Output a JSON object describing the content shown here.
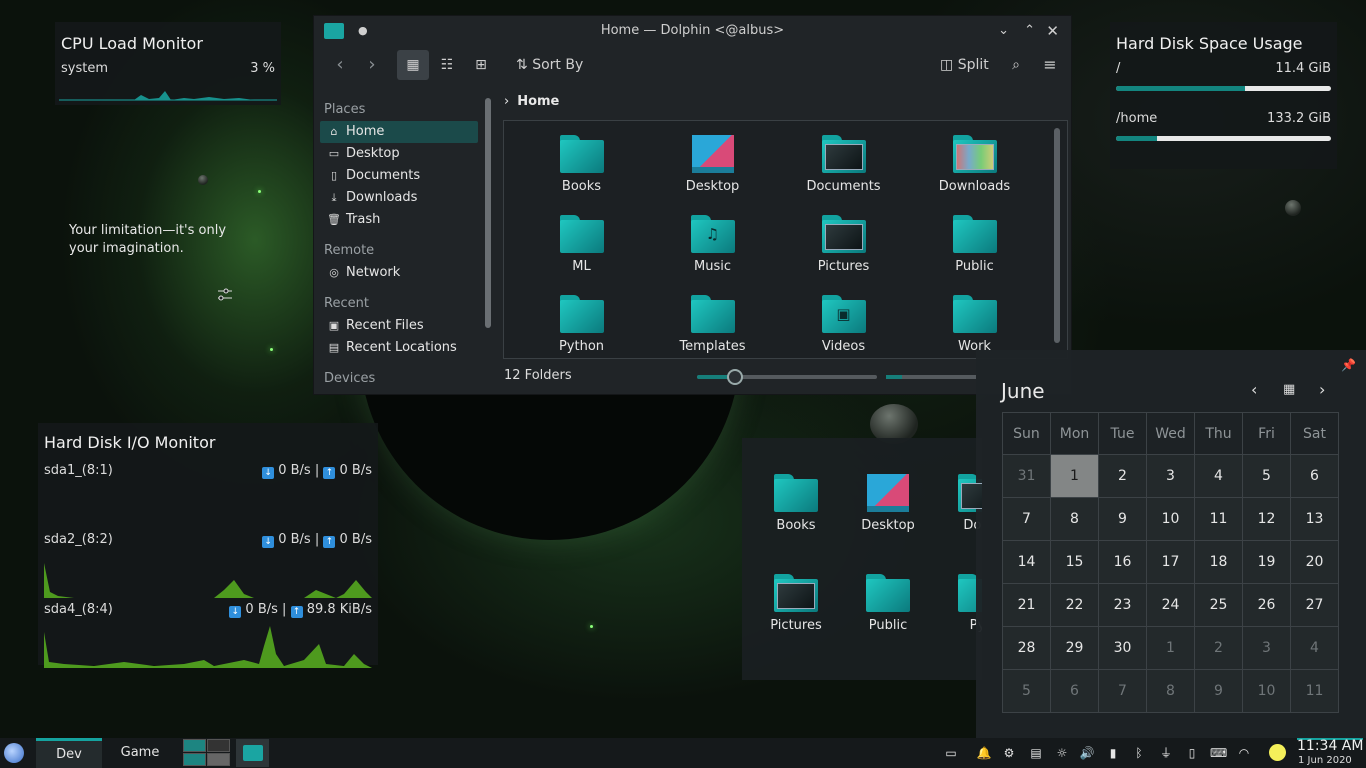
{
  "cpu": {
    "title": "CPU Load Monitor",
    "label": "system",
    "value": "3 %"
  },
  "quote": {
    "text": "Your limitation—it's only your imagination."
  },
  "disk_usage": {
    "title": "Hard Disk Space Usage",
    "drives": [
      {
        "label": "/",
        "value": "11.4 GiB",
        "fill": 0.6
      },
      {
        "label": "/home",
        "value": "133.2 GiB",
        "fill": 0.19
      }
    ]
  },
  "io": {
    "title": "Hard Disk I/O Monitor",
    "rows": [
      {
        "device": "sda1_(8:1)",
        "read": "0 B/s",
        "write": "0 B/s"
      },
      {
        "device": "sda2_(8:2)",
        "read": "0 B/s",
        "write": "0 B/s"
      },
      {
        "device": "sda4_(8:4)",
        "read": "0 B/s",
        "write": "89.8 KiB/s"
      }
    ]
  },
  "dolphin": {
    "title": "Home — Dolphin <@albus>",
    "sort_label": "Sort By",
    "split_label": "Split",
    "breadcrumb": "Home",
    "status": "12 Folders",
    "zoom": 0.2,
    "places_head": "Places",
    "places": [
      "Home",
      "Desktop",
      "Documents",
      "Downloads",
      "Trash"
    ],
    "remote_head": "Remote",
    "remote": [
      "Network"
    ],
    "recent_head": "Recent",
    "recent": [
      "Recent Files",
      "Recent Locations"
    ],
    "devices_head": "Devices",
    "folders": [
      "Books",
      "Desktop",
      "Documents",
      "Downloads",
      "ML",
      "Music",
      "Pictures",
      "Public",
      "Python",
      "Templates",
      "Videos",
      "Work"
    ]
  },
  "folder_view": {
    "folders": [
      "Books",
      "Desktop",
      "Docu",
      "Pictures",
      "Public",
      "Pyt"
    ]
  },
  "calendar": {
    "month": "June",
    "weekdays": [
      "Sun",
      "Mon",
      "Tue",
      "Wed",
      "Thu",
      "Fri",
      "Sat"
    ],
    "weeks": [
      [
        "31",
        "1",
        "2",
        "3",
        "4",
        "5",
        "6"
      ],
      [
        "7",
        "8",
        "9",
        "10",
        "11",
        "12",
        "13"
      ],
      [
        "14",
        "15",
        "16",
        "17",
        "18",
        "19",
        "20"
      ],
      [
        "21",
        "22",
        "23",
        "24",
        "25",
        "26",
        "27"
      ],
      [
        "28",
        "29",
        "30",
        "1",
        "2",
        "3",
        "4"
      ],
      [
        "5",
        "6",
        "7",
        "8",
        "9",
        "10",
        "11"
      ]
    ]
  },
  "taskbar": {
    "activities": [
      "Dev",
      "Game"
    ],
    "time": "11:34 AM",
    "date": "1 Jun 2020"
  }
}
